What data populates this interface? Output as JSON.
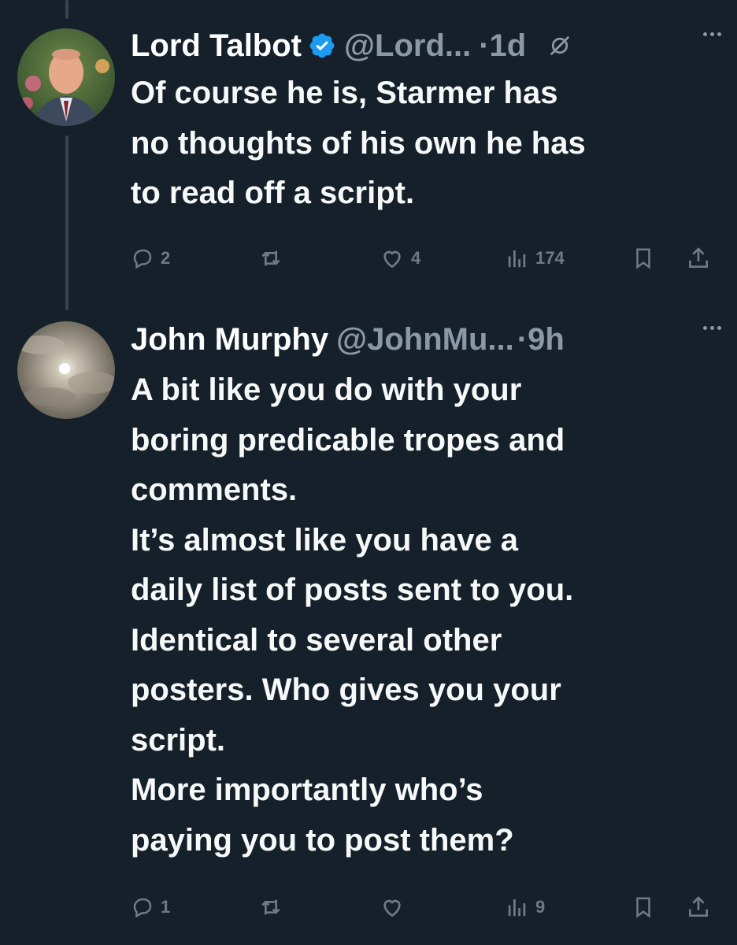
{
  "posts": [
    {
      "name": "Lord Talbot",
      "handle": "@Lord...",
      "time": "1d",
      "verified": true,
      "text": "Of course he is, Starmer has\nno thoughts of his own he has\nto read off a script.",
      "replies": "2",
      "reposts": "",
      "likes": "4",
      "views": "174"
    },
    {
      "name": "John Murphy",
      "handle": "@JohnMu...",
      "time": "9h",
      "verified": false,
      "text": "A bit like you do with your\nboring predicable tropes and\ncomments.\nIt’s almost like you have a\ndaily list of posts sent to you.\nIdentical to several other\nposters. Who gives you your\nscript.\nMore importantly who’s\npaying you to post them?",
      "replies": "1",
      "reposts": "",
      "likes": "",
      "views": "9"
    }
  ],
  "icons": {
    "reply": "reply-icon",
    "repost": "repost-icon",
    "like": "heart-icon",
    "views": "views-icon",
    "bookmark": "bookmark-icon",
    "share": "share-icon",
    "more": "more-icon",
    "verified": "verified-badge-icon",
    "grok": "grok-icon"
  },
  "colors": {
    "background": "#15202b",
    "text": "#f7f9f9",
    "secondary": "#8b98a5",
    "verified": "#1d9bf0"
  }
}
